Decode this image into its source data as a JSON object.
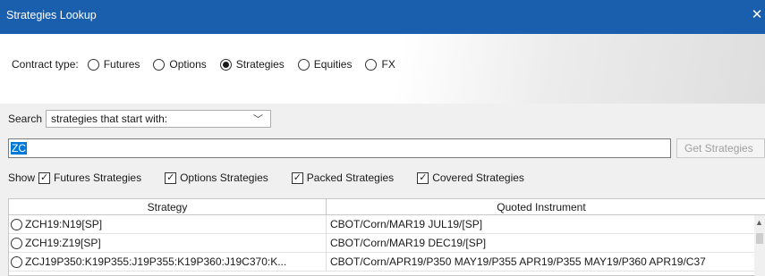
{
  "window": {
    "title": "Strategies Lookup",
    "close_glyph": "✕"
  },
  "contract": {
    "label": "Contract type:",
    "options": [
      {
        "label": "Futures",
        "selected": false
      },
      {
        "label": "Options",
        "selected": false
      },
      {
        "label": "Strategies",
        "selected": true
      },
      {
        "label": "Equities",
        "selected": false
      },
      {
        "label": "FX",
        "selected": false
      }
    ]
  },
  "search": {
    "label": "Search",
    "mode_value": "strategies that start with:",
    "query": "ZC",
    "button_label": "Get Strategies"
  },
  "show": {
    "label": "Show",
    "filters": [
      {
        "label": "Futures Strategies",
        "checked": true
      },
      {
        "label": "Options Strategies",
        "checked": true
      },
      {
        "label": "Packed Strategies",
        "checked": true
      },
      {
        "label": "Covered Strategies",
        "checked": true
      }
    ]
  },
  "table": {
    "columns": [
      "Strategy",
      "Quoted Instrument"
    ],
    "rows": [
      {
        "strategy": "ZCH19:N19[SP]",
        "instrument": "CBOT/Corn/MAR19 JUL19/[SP]"
      },
      {
        "strategy": "ZCH19:Z19[SP]",
        "instrument": "CBOT/Corn/MAR19 DEC19/[SP]"
      },
      {
        "strategy": "ZCJ19P350:K19P355:J19P355:K19P360:J19C370:K...",
        "instrument": "CBOT/Corn/APR19/P350 MAY19/P355 APR19/P355 MAY19/P360 APR19/C37"
      }
    ]
  },
  "icons": {
    "close": "close-icon",
    "dropdown": "chevron-down-icon",
    "scroll_up": "scroll-up-arrow-icon"
  }
}
